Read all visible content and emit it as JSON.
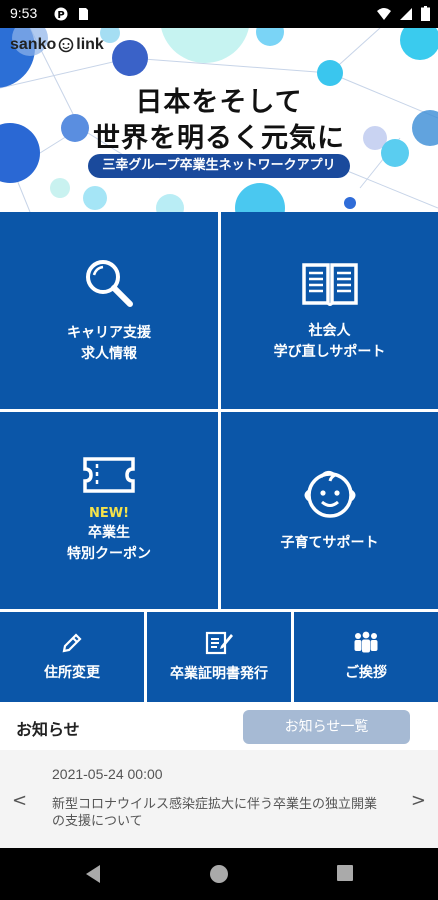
{
  "status_bar": {
    "time": "9:53"
  },
  "hero": {
    "logo_left": "sanko",
    "logo_right": "link",
    "headline_line1": "日本をそして",
    "headline_line2": "世界を明るく元気に",
    "tagline": "三幸グループ卒業生ネットワークアプリ"
  },
  "tiles": {
    "career": {
      "line1": "キャリア支援",
      "line2": "求人情報",
      "icon": "search-icon"
    },
    "relearn": {
      "line1": "社会人",
      "line2": "学び直しサポート",
      "icon": "book-icon"
    },
    "coupon": {
      "badge": "NEW!",
      "line1": "卒業生",
      "line2": "特別クーポン",
      "icon": "ticket-icon"
    },
    "childcare": {
      "line1": "子育てサポート",
      "icon": "baby-face-icon"
    },
    "address": {
      "label": "住所変更",
      "icon": "pencil-icon"
    },
    "certificate": {
      "label": "卒業証明書発行",
      "icon": "certificate-icon"
    },
    "greeting": {
      "label": "ご挨拶",
      "icon": "people-icon"
    }
  },
  "news": {
    "title": "お知らせ",
    "all_button": "お知らせ一覧",
    "item": {
      "date": "2021-05-24 00:00",
      "text": "新型コロナウイルス感染症拡大に伴う卒業生の独立開業の支援について"
    },
    "prev": "<",
    "next": ">"
  },
  "colors": {
    "tile_blue": "#0b56a8",
    "tagline_blue": "#1a4a9c",
    "news_button": "#a6bad4",
    "new_badge": "#f5e24a"
  }
}
